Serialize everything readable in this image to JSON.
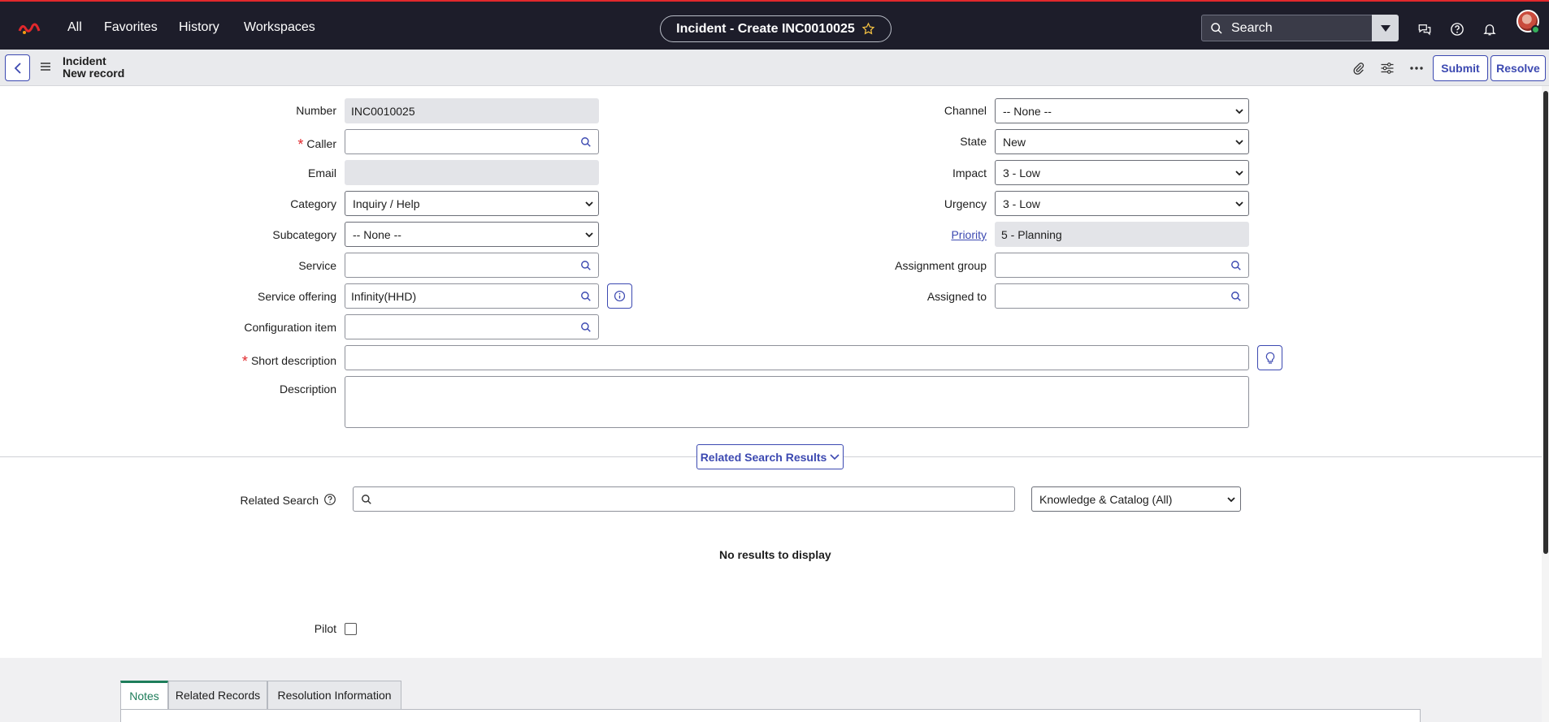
{
  "topnav": {
    "items": [
      "All",
      "Favorites",
      "History",
      "Workspaces"
    ],
    "page_title": "Incident - Create INC0010025",
    "search_label": "Search"
  },
  "record_header": {
    "table": "Incident",
    "subtitle": "New record",
    "submit_label": "Submit",
    "resolve_label": "Resolve"
  },
  "form": {
    "left": {
      "number": {
        "label": "Number",
        "value": "INC0010025"
      },
      "caller": {
        "label": "Caller",
        "value": "",
        "required": true
      },
      "email": {
        "label": "Email",
        "value": ""
      },
      "category": {
        "label": "Category",
        "value": "Inquiry / Help"
      },
      "subcategory": {
        "label": "Subcategory",
        "value": "-- None --"
      },
      "service": {
        "label": "Service",
        "value": ""
      },
      "service_offering": {
        "label": "Service offering",
        "value": "Infinity(HHD)"
      },
      "configuration_item": {
        "label": "Configuration item",
        "value": ""
      }
    },
    "right": {
      "channel": {
        "label": "Channel",
        "value": "-- None --"
      },
      "state": {
        "label": "State",
        "value": "New"
      },
      "impact": {
        "label": "Impact",
        "value": "3 - Low"
      },
      "urgency": {
        "label": "Urgency",
        "value": "3 - Low"
      },
      "priority": {
        "label": "Priority",
        "value": "5 - Planning"
      },
      "assignment_group": {
        "label": "Assignment group",
        "value": ""
      },
      "assigned_to": {
        "label": "Assigned to",
        "value": ""
      }
    },
    "short_description": {
      "label": "Short description",
      "value": "",
      "required": true
    },
    "description": {
      "label": "Description",
      "value": ""
    }
  },
  "related_search": {
    "toggle_label": "Related Search Results",
    "label": "Related Search",
    "query": "",
    "source": "Knowledge & Catalog (All)",
    "empty_message": "No results to display"
  },
  "pilot": {
    "label": "Pilot",
    "checked": false
  },
  "tabs": [
    {
      "label": "Notes",
      "active": true
    },
    {
      "label": "Related Records",
      "active": false
    },
    {
      "label": "Resolution Information",
      "active": false
    }
  ],
  "colors": {
    "nav_bg": "#1d1d2a",
    "accent": "#3c49b1",
    "required": "#e1282c",
    "active_tab": "#1e7d5a"
  },
  "icons": [
    "logo-icon",
    "star-icon",
    "search-icon",
    "chevron-down-icon",
    "chat-icon",
    "help-icon",
    "bell-icon",
    "avatar",
    "back-arrow-icon",
    "menu-icon",
    "paperclip-icon",
    "sliders-icon",
    "more-icon",
    "info-icon",
    "lightbulb-icon",
    "help-circle-icon"
  ]
}
